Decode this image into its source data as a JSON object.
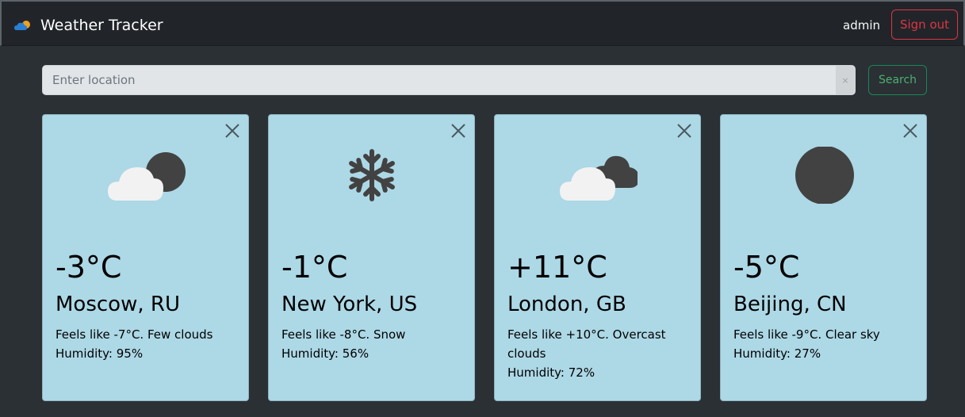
{
  "header": {
    "app_title": "Weather Tracker",
    "logo_icon": "cloud-sun-icon",
    "user": "admin",
    "signout_label": "Sign out"
  },
  "search": {
    "placeholder": "Enter location",
    "value": "",
    "clear_label": "×",
    "button_label": "Search"
  },
  "cards": [
    {
      "temp": "-3°C",
      "city": "Moscow, RU",
      "feels": "Feels like -7°C. Few clouds",
      "humidity": "Humidity: 95%",
      "icon": "few-clouds-night-icon"
    },
    {
      "temp": "-1°C",
      "city": "New York, US",
      "feels": "Feels like -8°C. Snow",
      "humidity": "Humidity: 56%",
      "icon": "snowflake-icon"
    },
    {
      "temp": "+11°C",
      "city": "London, GB",
      "feels": "Feels like +10°C. Overcast clouds",
      "humidity": "Humidity: 72%",
      "icon": "overcast-clouds-icon"
    },
    {
      "temp": "-5°C",
      "city": "Beijing, CN",
      "feels": "Feels like -9°C. Clear sky",
      "humidity": "Humidity: 27%",
      "icon": "clear-night-moon-icon"
    }
  ],
  "colors": {
    "page_bg": "#2b3035",
    "navbar_bg": "#212529",
    "card_bg": "#add8e6",
    "danger": "#dc3545",
    "success": "#198754"
  }
}
